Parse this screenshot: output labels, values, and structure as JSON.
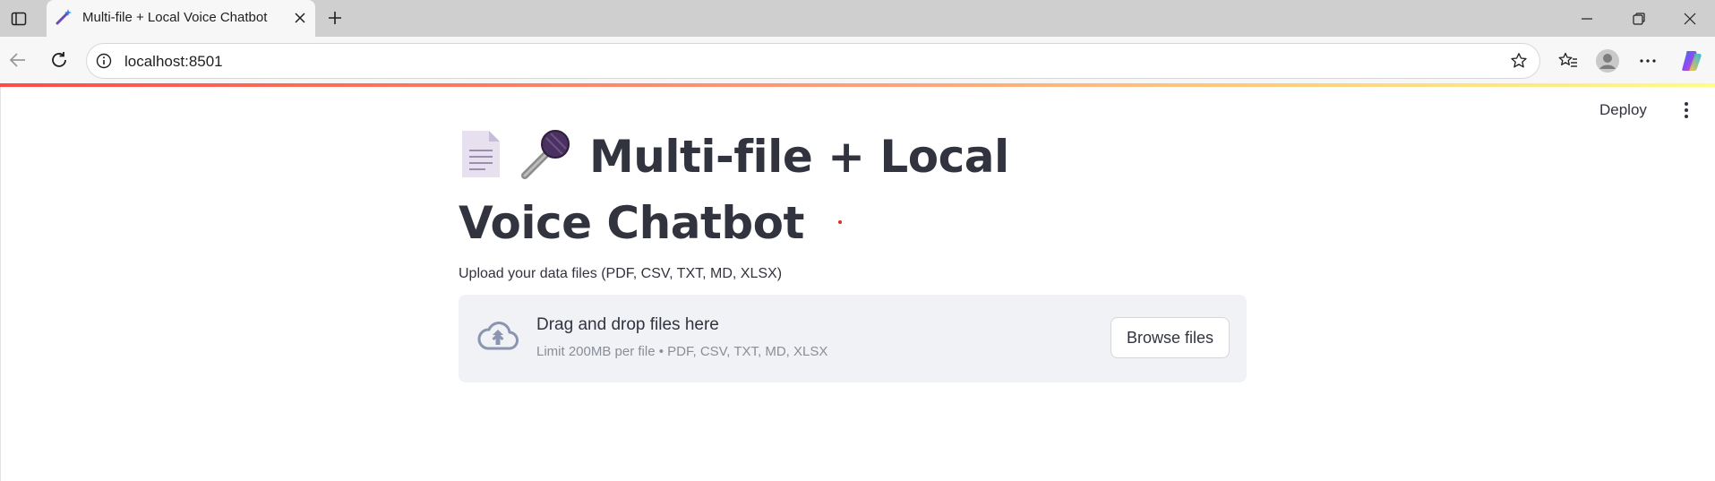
{
  "browser": {
    "tab_title": "Multi-file + Local Voice Chatbot",
    "url": "localhost:8501",
    "icons": {
      "tab_actions": "tab-actions-icon",
      "favicon": "magic-wand-icon",
      "close": "close-icon",
      "new_tab": "plus-icon",
      "minimize": "minimize-icon",
      "restore": "restore-icon",
      "window_close": "close-icon",
      "back": "back-arrow-icon",
      "reload": "reload-icon",
      "site_info": "info-icon",
      "favorite": "star-icon",
      "favorites_list": "favorites-icon",
      "profile": "avatar-icon",
      "more": "ellipsis-icon",
      "copilot": "copilot-icon"
    }
  },
  "app": {
    "deploy_label": "Deploy",
    "menu_icon": "kebab-menu-icon",
    "title_emoji_1": "📄",
    "title_emoji_2": "🎤",
    "title_text": "Multi-file + Local Voice Chatbot",
    "uploader": {
      "label": "Upload your data files (PDF, CSV, TXT, MD, XLSX)",
      "drop_title": "Drag and drop files here",
      "limit_text": "Limit 200MB per file • PDF, CSV, TXT, MD, XLSX",
      "browse_label": "Browse files",
      "icon": "cloud-upload-icon"
    }
  },
  "colors": {
    "text": "#31333f",
    "muted": "#8b8d98",
    "dropzone_bg": "#f0f2f6",
    "accent_red": "#ff4b4b",
    "accent_yellow": "#fffd80"
  }
}
